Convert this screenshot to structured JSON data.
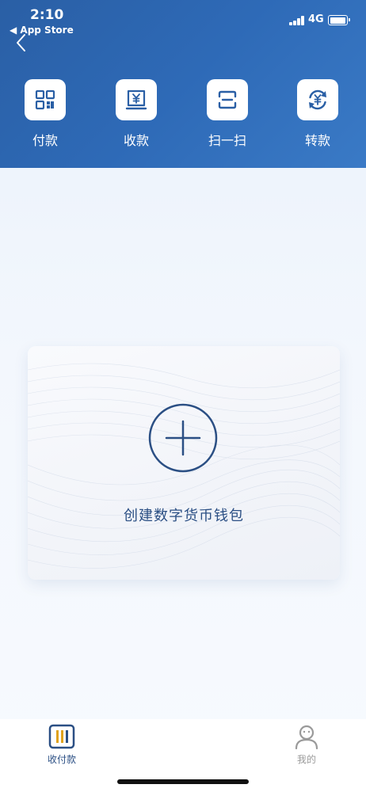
{
  "status_bar": {
    "time": "2:10",
    "back_app": "◀ App Store",
    "network": "4G"
  },
  "header": {
    "back_icon": "chevron-left-icon"
  },
  "actions": [
    {
      "label": "付款",
      "icon": "qr-code-icon"
    },
    {
      "label": "收款",
      "icon": "yuan-receipt-icon"
    },
    {
      "label": "扫一扫",
      "icon": "scan-icon"
    },
    {
      "label": "转款",
      "icon": "yuan-transfer-icon"
    }
  ],
  "wallet_card": {
    "label": "创建数字货币钱包",
    "icon": "plus-circle-icon"
  },
  "tabbar": [
    {
      "label": "收付款",
      "icon": "pay-receive-icon",
      "active": true
    },
    {
      "label": "我的",
      "icon": "profile-icon",
      "active": false
    }
  ],
  "colors": {
    "header_blue": "#2e6ab7",
    "accent": "#2b4f84",
    "tab_active": "#2b4f84",
    "tab_inactive": "#9a9a9a"
  }
}
